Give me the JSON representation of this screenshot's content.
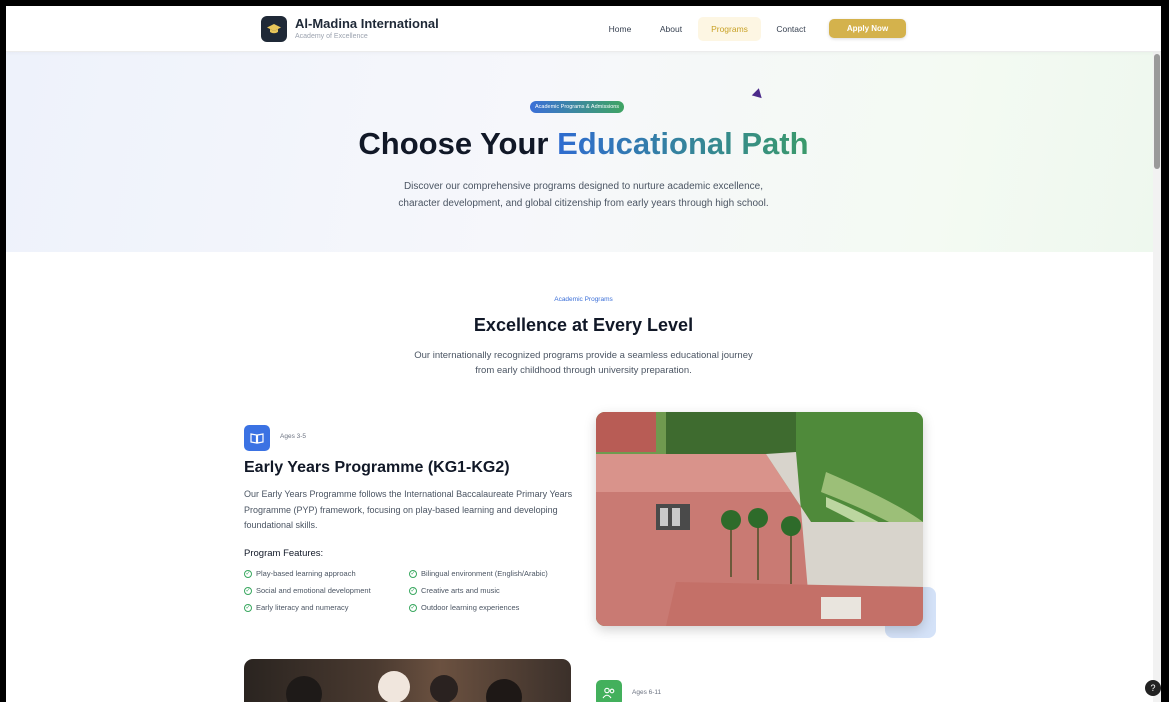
{
  "brand": {
    "title": "Al-Madina International",
    "subtitle": "Academy of Excellence"
  },
  "nav": {
    "home": "Home",
    "about": "About",
    "programs": "Programs",
    "contact": "Contact",
    "apply": "Apply Now"
  },
  "hero": {
    "badge": "Academic Programs & Admissions",
    "title_part1": "Choose Your ",
    "title_part2": "Educational Path",
    "desc_line1": "Discover our comprehensive programs designed to nurture academic excellence,",
    "desc_line2": "character development, and global citizenship from early years through high school."
  },
  "section": {
    "tag": "Academic Programs",
    "title": "Excellence at Every Level",
    "desc_line1": "Our internationally recognized programs provide a seamless educational journey",
    "desc_line2": "from early childhood through university preparation."
  },
  "program1": {
    "icon": "book-open-icon",
    "age": "Ages 3-5",
    "title": "Early Years Programme (KG1-KG2)",
    "desc": "Our Early Years Programme follows the International Baccalaureate Primary Years Programme (PYP) framework, focusing on play-based learning and developing foundational skills.",
    "features_title": "Program Features:",
    "features": [
      "Play-based learning approach",
      "Bilingual environment (English/Arabic)",
      "Social and emotional development",
      "Creative arts and music",
      "Early literacy and numeracy",
      "Outdoor learning experiences"
    ]
  },
  "program2": {
    "icon": "users-icon",
    "age": "Ages 6-11"
  },
  "colors": {
    "gold": "#d4b24c",
    "blue": "#3b72e3",
    "green": "#43b05c",
    "dark": "#1f2937"
  }
}
